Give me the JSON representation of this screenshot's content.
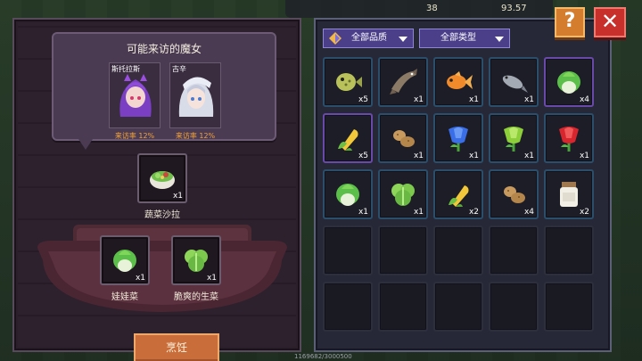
{
  "hud": {
    "value_1": "38",
    "value_2": "93.57"
  },
  "visitor_panel": {
    "title": "可能来访的魔女",
    "witches": [
      {
        "name": "斯托拉斯",
        "rate_label": "来访率",
        "rate": "12%",
        "hair": "#7b3fc4",
        "icon": "purple-witch-portrait-icon"
      },
      {
        "name": "古辛",
        "rate_label": "来访率",
        "rate": "12%",
        "hair": "#d8dbe8",
        "icon": "white-witch-portrait-icon"
      }
    ]
  },
  "recipe": {
    "result": {
      "name": "蔬菜沙拉",
      "qty": "x1",
      "icon": "salad-bowl-icon"
    },
    "ingredients": [
      {
        "name": "娃娃菜",
        "qty": "x1",
        "icon": "baby-cabbage-icon"
      },
      {
        "name": "脆爽的生菜",
        "qty": "x1",
        "icon": "lettuce-icon"
      }
    ],
    "cook_label": "烹饪"
  },
  "inventory": {
    "filters": {
      "quality": "全部品质",
      "type": "全部类型"
    },
    "items": [
      {
        "icon": "pufferfish-icon",
        "qty": "x5",
        "rare": false
      },
      {
        "icon": "catfish-icon",
        "qty": "x1",
        "rare": false
      },
      {
        "icon": "goldfish-icon",
        "qty": "x1",
        "rare": false
      },
      {
        "icon": "grey-fish-icon",
        "qty": "x1",
        "rare": false
      },
      {
        "icon": "cabbage-icon",
        "qty": "x4",
        "rare": true
      },
      {
        "icon": "corn-icon",
        "qty": "x5",
        "rare": true
      },
      {
        "icon": "potato-icon",
        "qty": "x1",
        "rare": false
      },
      {
        "icon": "blue-flower-icon",
        "qty": "x1",
        "rare": false
      },
      {
        "icon": "green-flower-icon",
        "qty": "x1",
        "rare": false
      },
      {
        "icon": "red-flower-icon",
        "qty": "x1",
        "rare": false
      },
      {
        "icon": "cabbage-icon",
        "qty": "x1",
        "rare": false
      },
      {
        "icon": "lettuce-icon",
        "qty": "x1",
        "rare": false
      },
      {
        "icon": "corn-icon",
        "qty": "x2",
        "rare": false
      },
      {
        "icon": "potato-icon",
        "qty": "x4",
        "rare": false
      },
      {
        "icon": "milk-jar-icon",
        "qty": "x2",
        "rare": false
      }
    ],
    "empty_slots": 10
  },
  "buttons": {
    "help": "?",
    "close": "✕"
  },
  "footer": "1169682/3000500"
}
